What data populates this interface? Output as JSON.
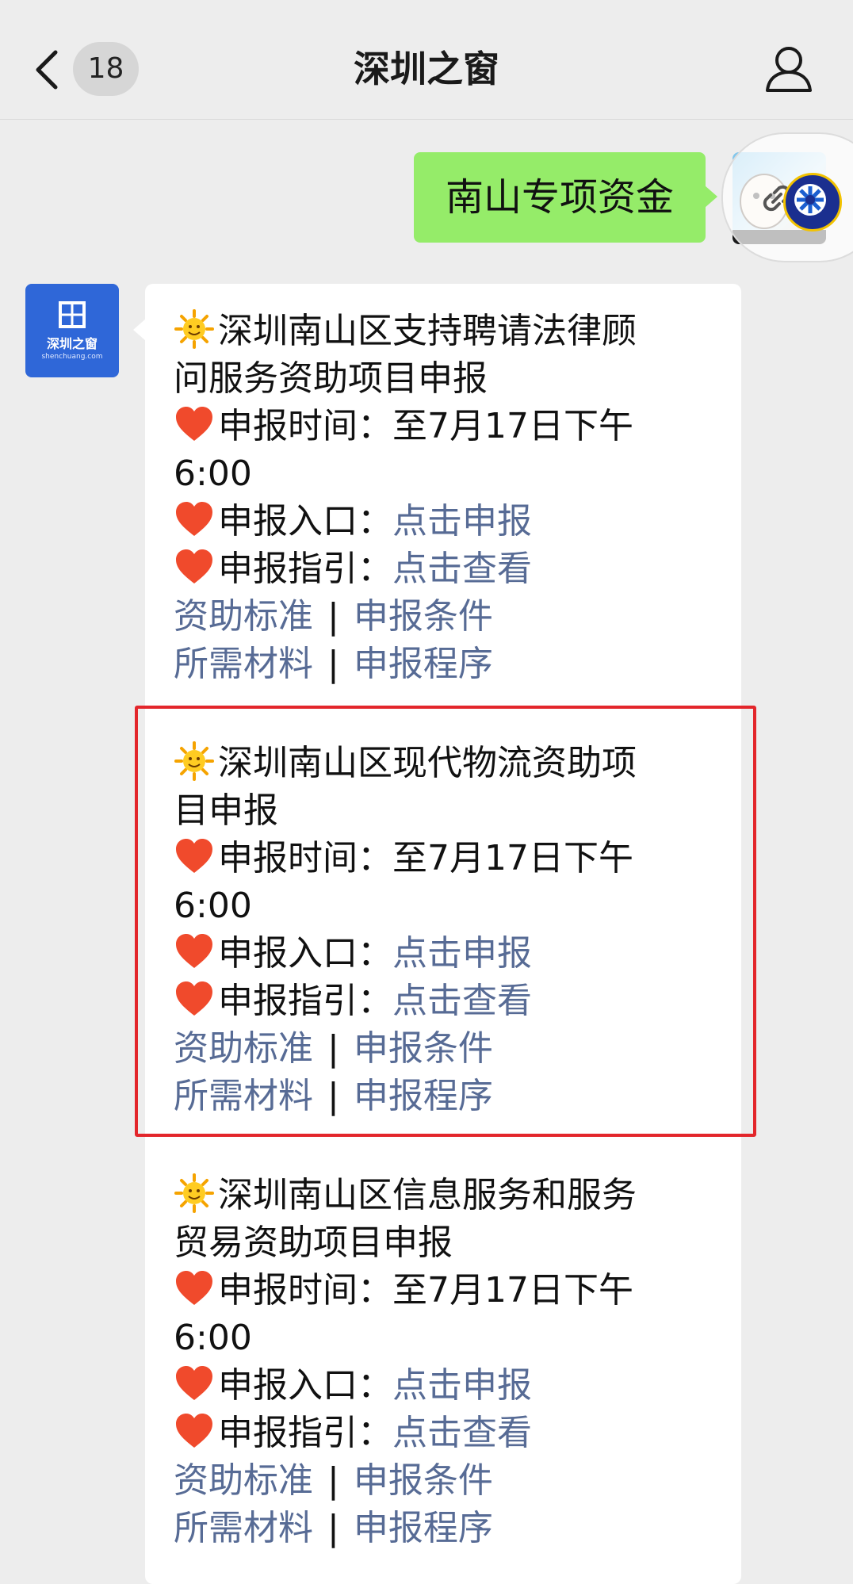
{
  "header": {
    "title": "深圳之窗",
    "badge_count": "18"
  },
  "user_message": {
    "text": "南山专项资金"
  },
  "bot": {
    "logo_text": "深圳之窗",
    "logo_sub": "shenchuang.com"
  },
  "cards": [
    {
      "title_line1": "深圳南山区支持聘请法律顾",
      "title_line2": "问服务资助项目申报",
      "time_label": "申报时间：",
      "time_value": "至7月17日下午",
      "time_value2": "6:00",
      "entry_label": "申报入口：",
      "entry_link": "点击申报",
      "guide_label": "申报指引：",
      "guide_link": "点击查看",
      "link_std": "资助标准",
      "link_cond": "申报条件",
      "link_mat": "所需材料",
      "link_proc": "申报程序",
      "separator": "|"
    },
    {
      "title_line1": "深圳南山区现代物流资助项",
      "title_line2": "目申报",
      "time_label": "申报时间：",
      "time_value": "至7月17日下午",
      "time_value2": "6:00",
      "entry_label": "申报入口：",
      "entry_link": "点击申报",
      "guide_label": "申报指引：",
      "guide_link": "点击查看",
      "link_std": "资助标准",
      "link_cond": "申报条件",
      "link_mat": "所需材料",
      "link_proc": "申报程序",
      "separator": "|"
    },
    {
      "title_line1": "深圳南山区信息服务和服务",
      "title_line2": "贸易资助项目申报",
      "time_label": "申报时间：",
      "time_value": "至7月17日下午",
      "time_value2": "6:00",
      "entry_label": "申报入口：",
      "entry_link": "点击申报",
      "guide_label": "申报指引：",
      "guide_link": "点击查看",
      "link_std": "资助标准",
      "link_cond": "申报条件",
      "link_mat": "所需材料",
      "link_proc": "申报程序",
      "separator": "|"
    }
  ],
  "icons": {
    "back": "chevron-left-icon",
    "profile": "person-icon",
    "sun": "sun-emoji-icon",
    "heart": "heart-emoji-icon",
    "link": "link-icon"
  },
  "colors": {
    "background": "#ededed",
    "user_bubble": "#95ec69",
    "link": "#576b95",
    "highlight": "#e3262b"
  }
}
